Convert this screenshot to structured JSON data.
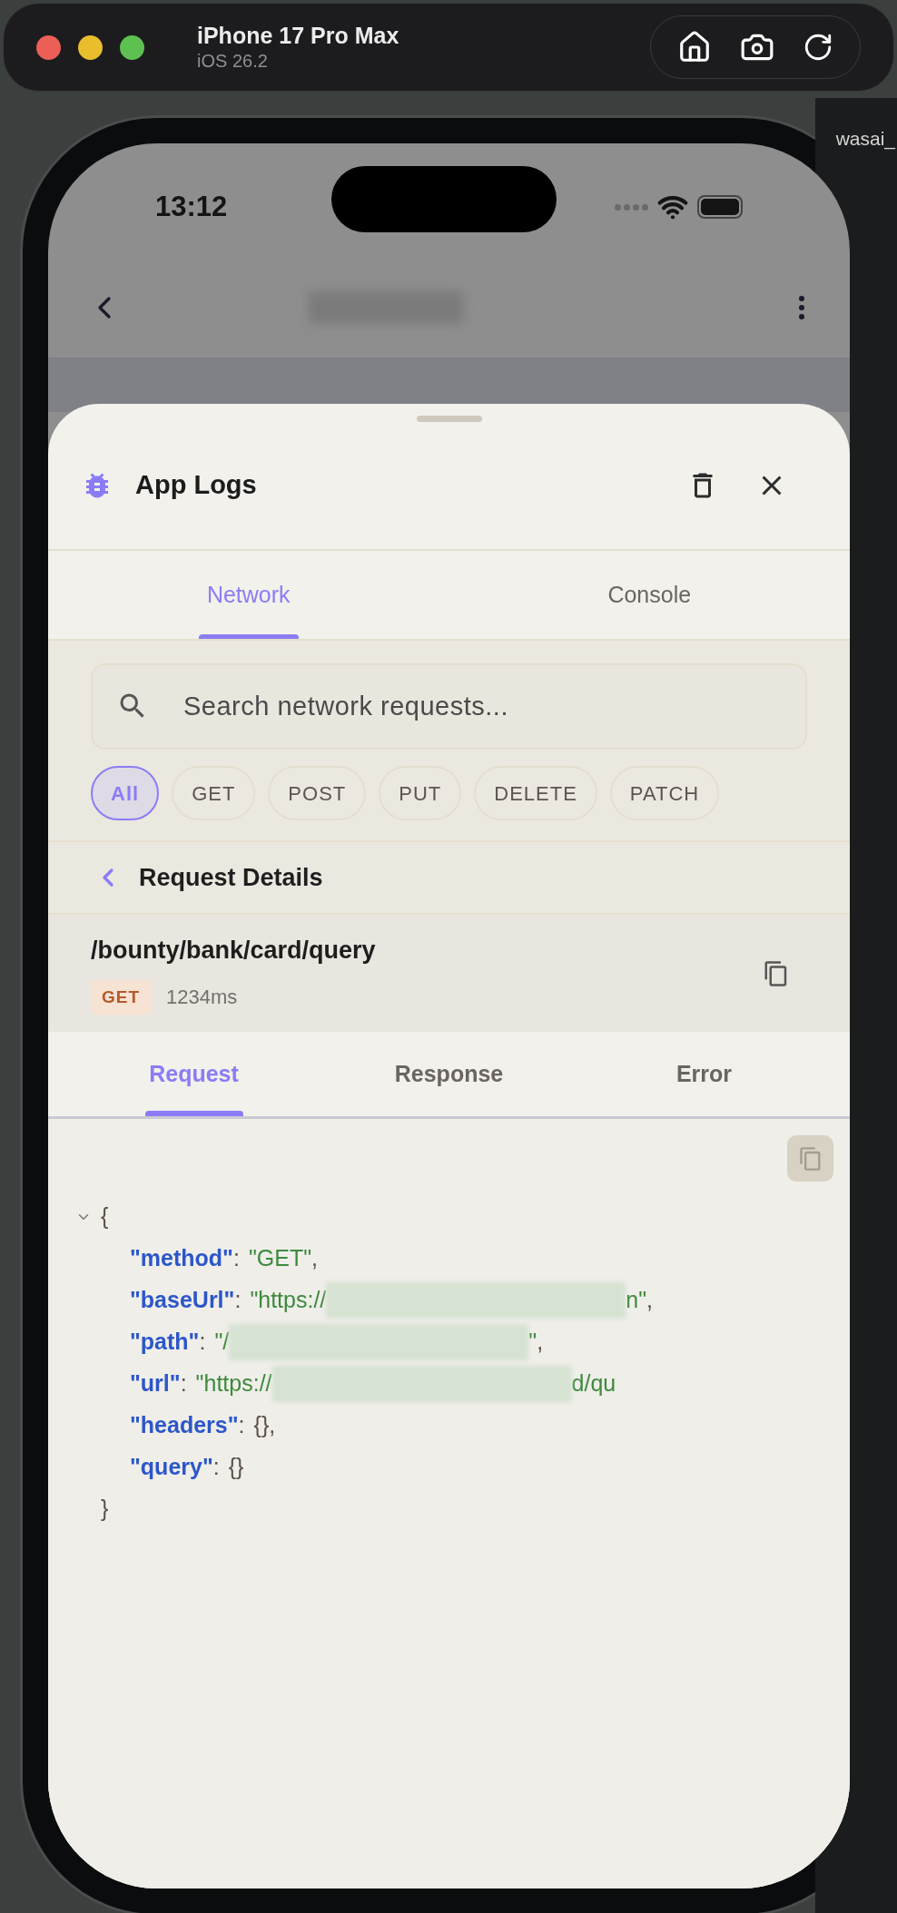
{
  "simulator": {
    "device": "iPhone 17 Pro Max",
    "os": "iOS 26.2"
  },
  "desktop": {
    "panel_text": "wasai_"
  },
  "status_bar": {
    "time": "13:12"
  },
  "sheet": {
    "title": "App Logs",
    "tabs": [
      {
        "label": "Network",
        "selected": true
      },
      {
        "label": "Console",
        "selected": false
      }
    ],
    "search": {
      "placeholder": "Search network requests..."
    },
    "filters": [
      {
        "label": "All",
        "selected": true
      },
      {
        "label": "GET",
        "selected": false
      },
      {
        "label": "POST",
        "selected": false
      },
      {
        "label": "PUT",
        "selected": false
      },
      {
        "label": "DELETE",
        "selected": false
      },
      {
        "label": "PATCH",
        "selected": false
      }
    ],
    "details": {
      "title": "Request Details",
      "path": "/bounty/bank/card/query",
      "method": "GET",
      "duration": "1234ms",
      "tabs": [
        {
          "label": "Request",
          "selected": true
        },
        {
          "label": "Response",
          "selected": false
        },
        {
          "label": "Error",
          "selected": false
        }
      ],
      "json": {
        "expanded": true,
        "open": "{",
        "close": "}",
        "entries": [
          {
            "key": "\"method\"",
            "colon": ":",
            "kind": "string",
            "value": "\"GET\"",
            "redacted": false,
            "tail": ","
          },
          {
            "key": "\"baseUrl\"",
            "colon": ":",
            "kind": "string",
            "value": "\"https://",
            "redacted": true,
            "value_after": "n\"",
            "tail": ","
          },
          {
            "key": "\"path\"",
            "colon": ":",
            "kind": "string",
            "value": "\"/",
            "redacted": true,
            "value_after": "\"",
            "tail": ","
          },
          {
            "key": "\"url\"",
            "colon": ":",
            "kind": "string",
            "value": "\"https://",
            "redacted": true,
            "value_after": "d/qu"
          },
          {
            "key": "\"headers\"",
            "colon": ":",
            "kind": "object",
            "value": "{}",
            "redacted": false,
            "tail": ","
          },
          {
            "key": "\"query\"",
            "colon": ":",
            "kind": "object",
            "value": "{}",
            "redacted": false
          }
        ]
      }
    }
  }
}
